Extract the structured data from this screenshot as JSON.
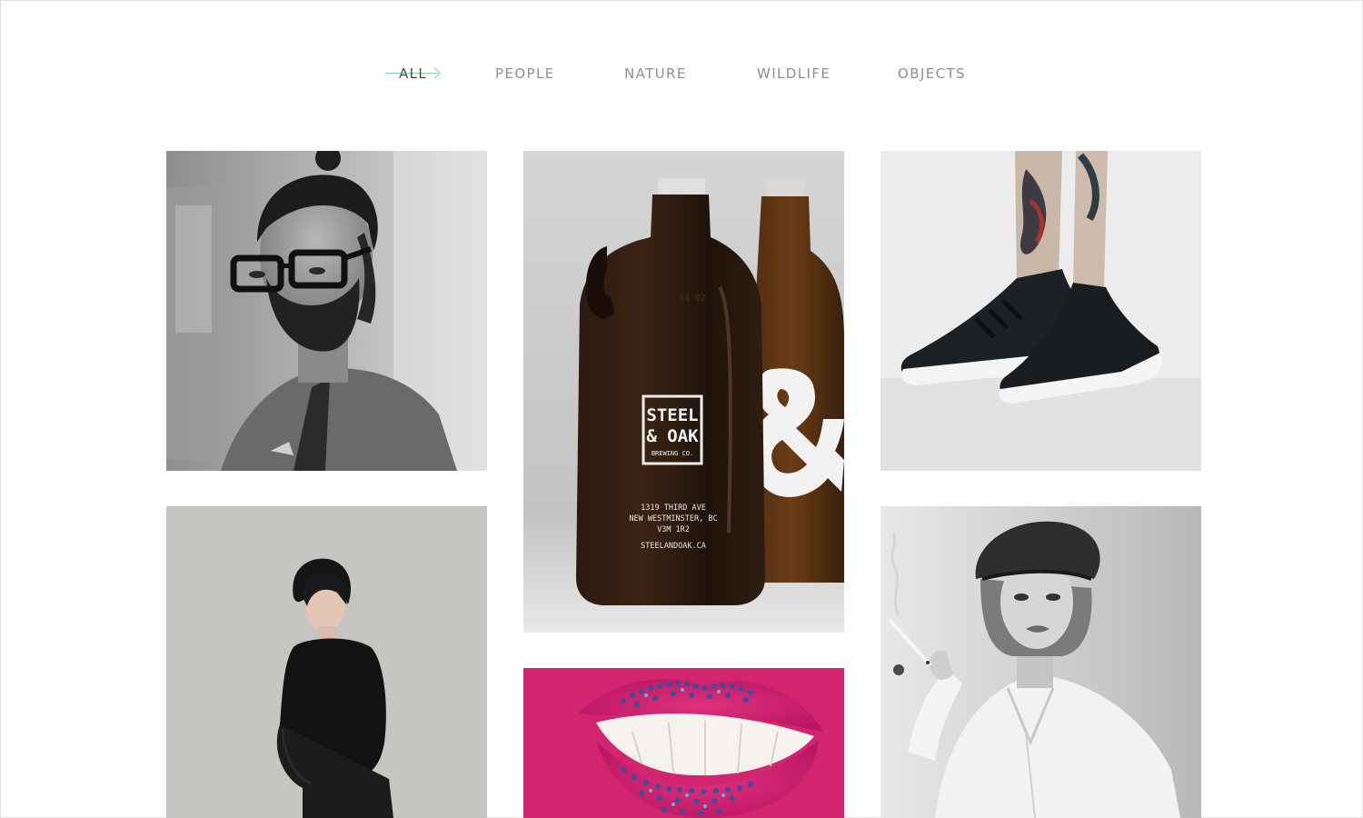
{
  "filter_nav": {
    "items": [
      {
        "label": "ALL",
        "active": true
      },
      {
        "label": "PEOPLE",
        "active": false
      },
      {
        "label": "NATURE",
        "active": false
      },
      {
        "label": "WILDLIFE",
        "active": false
      },
      {
        "label": "OBJECTS",
        "active": false
      }
    ],
    "accent_color": "#7fd89a"
  },
  "gallery": {
    "items": [
      {
        "subject": "man with glasses portrait",
        "category": "people",
        "tone": "grayscale"
      },
      {
        "subject": "steel and oak growler bottles",
        "category": "objects",
        "tone": "color",
        "label": {
          "brand_line1": "STEEL",
          "brand_line2": "& OAK",
          "brand_line3": "BREWING CO.",
          "address_line1": "1319 THIRD AVE",
          "address_line2": "NEW WESTMINSTER, BC",
          "address_line3": "V3M 1R2",
          "website": "STEELANDOAK.CA",
          "second_bottle_mark": "&",
          "embossed_mark": "64 OZ"
        }
      },
      {
        "subject": "tattooed legs with sneakers",
        "category": "people",
        "tone": "color"
      },
      {
        "subject": "woman in black blouse",
        "category": "people",
        "tone": "color"
      },
      {
        "subject": "pink lips with beads",
        "category": "people",
        "tone": "color"
      },
      {
        "subject": "woman in beret smoking",
        "category": "people",
        "tone": "grayscale"
      }
    ]
  }
}
